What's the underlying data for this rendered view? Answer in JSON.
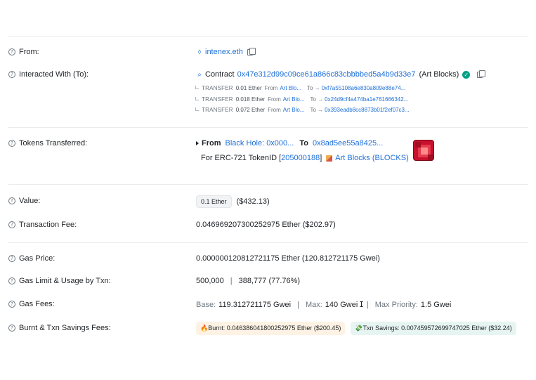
{
  "from": {
    "label": "From:",
    "address": "intenex.eth"
  },
  "interacted": {
    "label": "Interacted With (To):",
    "prefix": "Contract",
    "address": "0x47e312d99c09ce61a866c83cbbbbed5a4b9d33e7",
    "name": "(Art Blocks)",
    "transfers": [
      {
        "kind": "TRANSFER",
        "amount": "0.01 Ether",
        "from_word": "From",
        "from": "Art Blo...",
        "to_word": "To →",
        "to": "0xf7a55108a6e830a809e88e74..."
      },
      {
        "kind": "TRANSFER",
        "amount": "0.018 Ether",
        "from_word": "From",
        "from": "Art Blo...",
        "to_word": "To →",
        "to": "0x24d9cf4a474ba1e761666342..."
      },
      {
        "kind": "TRANSFER",
        "amount": "0.072 Ether",
        "from_word": "From",
        "from": "Art Blo...",
        "to_word": "To →",
        "to": "0x393eadb8cc8873b01f2ef07c3..."
      }
    ]
  },
  "tokens": {
    "label": "Tokens Transferred:",
    "from_word": "From",
    "from": "Black Hole: 0x000...",
    "to_word": "To",
    "to": "0x8ad5ee55a8425...",
    "for_prefix": "For ERC-721 TokenID [",
    "token_id": "205000188",
    "for_suffix": "]",
    "collection": "Art Blocks (BLOCKS)"
  },
  "value": {
    "label": "Value:",
    "amount": "0.1 Ether",
    "usd": "($432.13)"
  },
  "fee": {
    "label": "Transaction Fee:",
    "amount": "0.046969207300252975 Ether ($202.97)"
  },
  "gas_price": {
    "label": "Gas Price:",
    "amount": "0.000000120812721175 Ether (120.812721175 Gwei)"
  },
  "gas_limit": {
    "label": "Gas Limit & Usage by Txn:",
    "limit": "500,000",
    "sep": "|",
    "usage": "388,777 (77.76%)"
  },
  "gas_fees": {
    "label": "Gas Fees:",
    "base_label": "Base:",
    "base": "119.312721175 Gwei",
    "max_label": "Max:",
    "max": "140 Gwei",
    "priority_label": "Max Priority:",
    "priority": "1.5 Gwei",
    "sep": "|"
  },
  "burnt": {
    "label": "Burnt & Txn Savings Fees:",
    "burnt": "🔥Burnt: 0.046386041800252975 Ether ($200.45)",
    "savings": "💸Txn Savings: 0.007459572699747025 Ether ($32.24)"
  },
  "icons": {
    "help": "question-circle-icon",
    "copy": "copy-icon",
    "eth": "ens-icon",
    "contract": "contract-search-icon",
    "verified": "check-circle-icon"
  },
  "colors": {
    "link": "#1e6fd9",
    "verified": "#00a186"
  }
}
